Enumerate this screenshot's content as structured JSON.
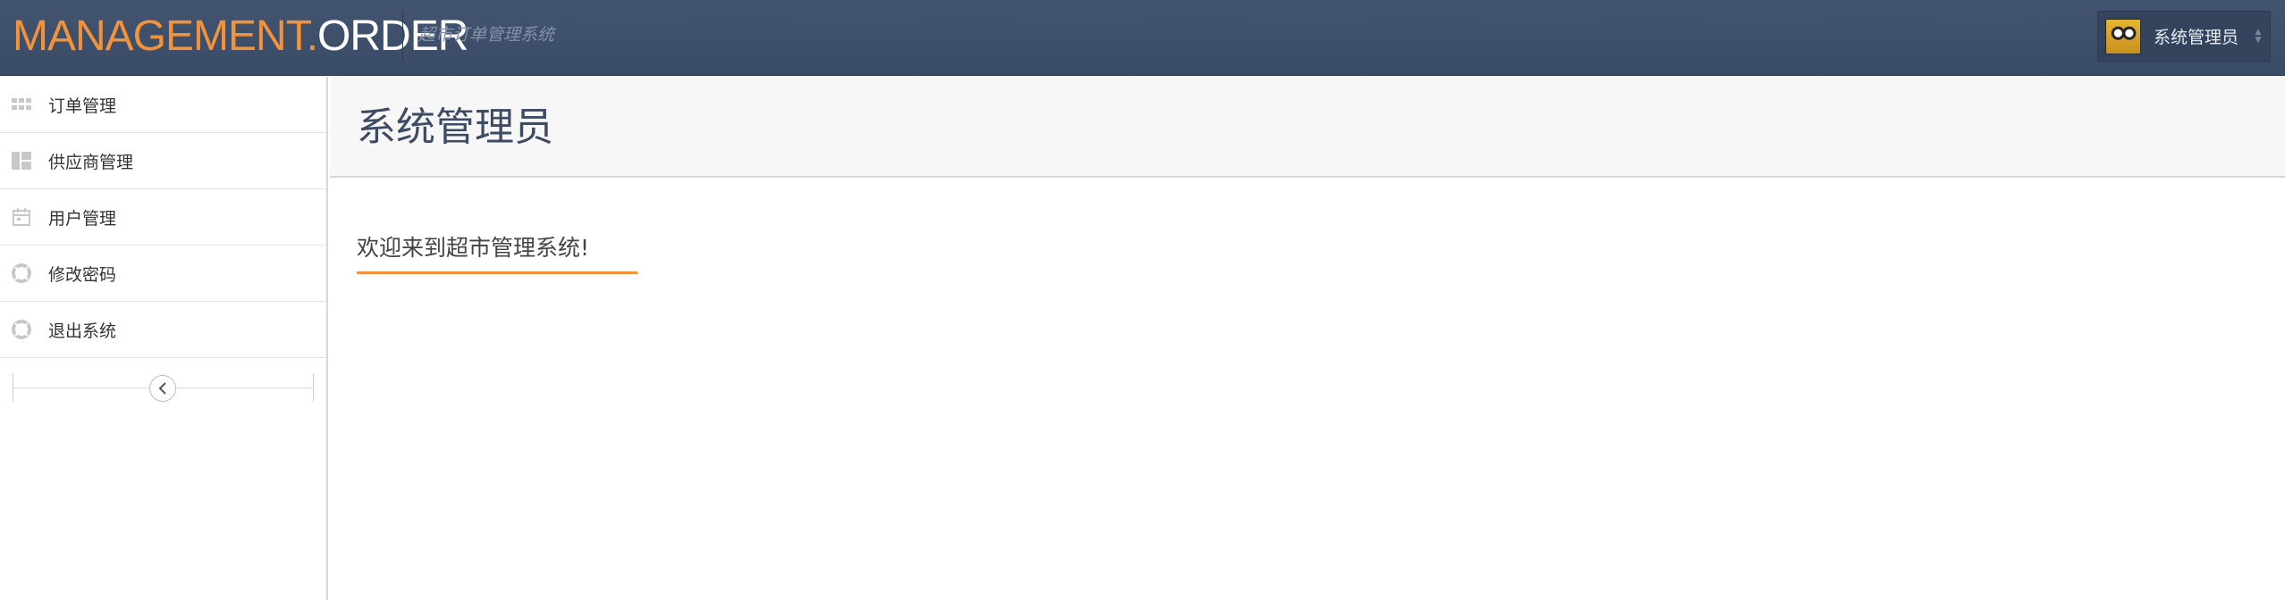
{
  "header": {
    "brand_part1": "MANAGEMENT.",
    "brand_part2": "ORDER",
    "subtitle": "超市订单管理系统",
    "user_name": "系统管理员",
    "brand_color": "#f2923a",
    "bar_color": "#3d4f6b"
  },
  "sidebar": {
    "items": [
      {
        "label": "订单管理",
        "icon": "grid-icon"
      },
      {
        "label": "供应商管理",
        "icon": "dashboard-layout-icon"
      },
      {
        "label": "用户管理",
        "icon": "calendar-icon"
      },
      {
        "label": "修改密码",
        "icon": "lifebuoy-icon"
      },
      {
        "label": "退出系统",
        "icon": "lifebuoy-icon"
      }
    ],
    "collapse_icon": "chevron-left-icon"
  },
  "main": {
    "page_title": "系统管理员",
    "welcome_text": "欢迎来到超市管理系统!"
  }
}
